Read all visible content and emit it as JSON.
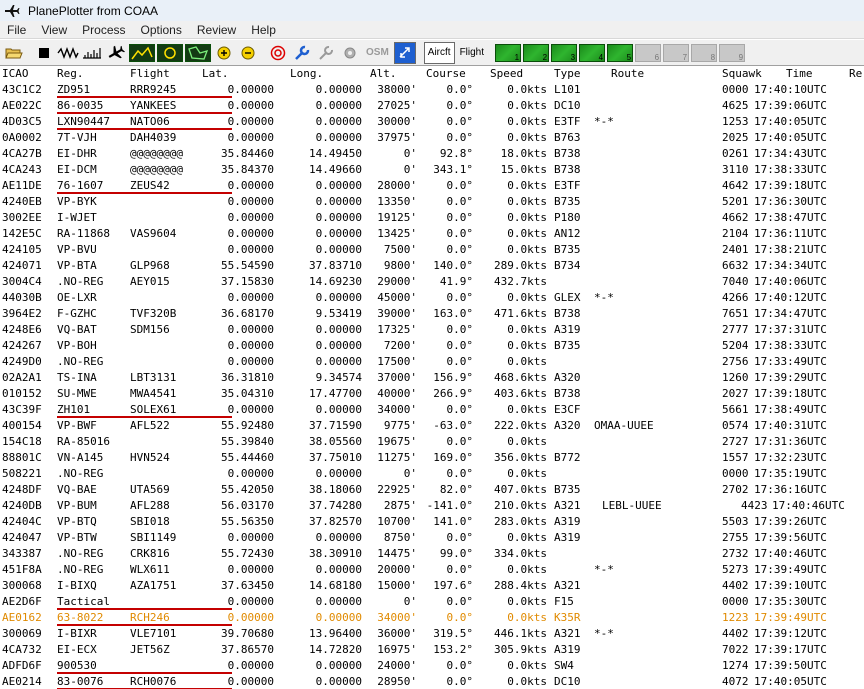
{
  "window": {
    "title": "PlanePlotter from COAA",
    "app_icon": "airplane-icon"
  },
  "menu": [
    "File",
    "View",
    "Process",
    "Options",
    "Review",
    "Help"
  ],
  "toolbar": {
    "text_buttons": {
      "osm": "OSM",
      "aircraft": "Aircft",
      "flight": "Flight"
    },
    "map_numbers": [
      "1",
      "2",
      "3",
      "4",
      "5"
    ],
    "grey_numbers": [
      "6",
      "7",
      "8",
      "9"
    ]
  },
  "table": {
    "columns": [
      "ICAO",
      "Reg.",
      "Flight",
      "Lat.",
      "Long.",
      "Alt.",
      "Course",
      "Speed",
      "Type",
      "Route",
      "Squawk",
      "Time",
      "Re"
    ],
    "rows": [
      {
        "icao": "43C1C2",
        "reg": "ZD951",
        "flight": "RRR9245",
        "lat": "0.00000",
        "long": "0.00000",
        "alt": "38000'",
        "course": "0.0°",
        "speed": "0.0kts",
        "type": "L101",
        "route": "",
        "squawk": "0000",
        "time": "17:40:10UTC",
        "underline": true
      },
      {
        "icao": "AE022C",
        "reg": "86-0035",
        "flight": "YANKEES",
        "lat": "0.00000",
        "long": "0.00000",
        "alt": "27025'",
        "course": "0.0°",
        "speed": "0.0kts",
        "type": "DC10",
        "route": "",
        "squawk": "4625",
        "time": "17:39:06UTC",
        "underline": true
      },
      {
        "icao": "4D03C5",
        "reg": "LXN90447",
        "flight": "NATO06",
        "lat": "0.00000",
        "long": "0.00000",
        "alt": "30000'",
        "course": "0.0°",
        "speed": "0.0kts",
        "type": "E3TF",
        "route": "*-*",
        "squawk": "1253",
        "time": "17:40:05UTC",
        "underline": true
      },
      {
        "icao": "0A0002",
        "reg": "7T-VJH",
        "flight": "DAH4039",
        "lat": "0.00000",
        "long": "0.00000",
        "alt": "37975'",
        "course": "0.0°",
        "speed": "0.0kts",
        "type": "B763",
        "route": "",
        "squawk": "2025",
        "time": "17:40:05UTC"
      },
      {
        "icao": "4CA27B",
        "reg": "EI-DHR",
        "flight": "@@@@@@@@",
        "lat": "35.84460",
        "long": "14.49450",
        "alt": "0'",
        "course": "92.8°",
        "speed": "18.0kts",
        "type": "B738",
        "route": "",
        "squawk": "0261",
        "time": "17:34:43UTC"
      },
      {
        "icao": "4CA243",
        "reg": "EI-DCM",
        "flight": "@@@@@@@@",
        "lat": "35.84370",
        "long": "14.49660",
        "alt": "0'",
        "course": "343.1°",
        "speed": "15.0kts",
        "type": "B738",
        "route": "",
        "squawk": "3110",
        "time": "17:38:33UTC"
      },
      {
        "icao": "AE11DE",
        "reg": "76-1607",
        "flight": "ZEUS42",
        "lat": "0.00000",
        "long": "0.00000",
        "alt": "28000'",
        "course": "0.0°",
        "speed": "0.0kts",
        "type": "E3TF",
        "route": "",
        "squawk": "4642",
        "time": "17:39:18UTC",
        "underline": true
      },
      {
        "icao": "4240EB",
        "reg": "VP-BYK",
        "flight": "",
        "lat": "0.00000",
        "long": "0.00000",
        "alt": "13350'",
        "course": "0.0°",
        "speed": "0.0kts",
        "type": "B735",
        "route": "",
        "squawk": "5201",
        "time": "17:36:30UTC"
      },
      {
        "icao": "3002EE",
        "reg": "I-WJET",
        "flight": "",
        "lat": "0.00000",
        "long": "0.00000",
        "alt": "19125'",
        "course": "0.0°",
        "speed": "0.0kts",
        "type": "P180",
        "route": "",
        "squawk": "4662",
        "time": "17:38:47UTC"
      },
      {
        "icao": "142E5C",
        "reg": "RA-11868",
        "flight": "VAS9604",
        "lat": "0.00000",
        "long": "0.00000",
        "alt": "13425'",
        "course": "0.0°",
        "speed": "0.0kts",
        "type": "AN12",
        "route": "",
        "squawk": "2104",
        "time": "17:36:11UTC"
      },
      {
        "icao": "424105",
        "reg": "VP-BVU",
        "flight": "",
        "lat": "0.00000",
        "long": "0.00000",
        "alt": "7500'",
        "course": "0.0°",
        "speed": "0.0kts",
        "type": "B735",
        "route": "",
        "squawk": "2401",
        "time": "17:38:21UTC"
      },
      {
        "icao": "424071",
        "reg": "VP-BTA",
        "flight": "GLP968",
        "lat": "55.54590",
        "long": "37.83710",
        "alt": "9800'",
        "course": "140.0°",
        "speed": "289.0kts",
        "type": "B734",
        "route": "",
        "squawk": "6632",
        "time": "17:34:34UTC"
      },
      {
        "icao": "3004C4",
        "reg": ".NO-REG",
        "flight": "AEY015",
        "lat": "37.15830",
        "long": "14.69230",
        "alt": "29000'",
        "course": "41.9°",
        "speed": "432.7kts",
        "type": "",
        "route": "",
        "squawk": "7040",
        "time": "17:40:06UTC"
      },
      {
        "icao": "44030B",
        "reg": "OE-LXR",
        "flight": "",
        "lat": "0.00000",
        "long": "0.00000",
        "alt": "45000'",
        "course": "0.0°",
        "speed": "0.0kts",
        "type": "GLEX",
        "route": "*-*",
        "squawk": "4266",
        "time": "17:40:12UTC"
      },
      {
        "icao": "3964E2",
        "reg": "F-GZHC",
        "flight": "TVF320B",
        "lat": "36.68170",
        "long": "9.53419",
        "alt": "39000'",
        "course": "163.0°",
        "speed": "471.6kts",
        "type": "B738",
        "route": "",
        "squawk": "7651",
        "time": "17:34:47UTC"
      },
      {
        "icao": "4248E6",
        "reg": "VQ-BAT",
        "flight": "SDM156",
        "lat": "0.00000",
        "long": "0.00000",
        "alt": "17325'",
        "course": "0.0°",
        "speed": "0.0kts",
        "type": "A319",
        "route": "",
        "squawk": "2777",
        "time": "17:37:31UTC"
      },
      {
        "icao": "424267",
        "reg": "VP-BOH",
        "flight": "",
        "lat": "0.00000",
        "long": "0.00000",
        "alt": "7200'",
        "course": "0.0°",
        "speed": "0.0kts",
        "type": "B735",
        "route": "",
        "squawk": "5204",
        "time": "17:38:33UTC"
      },
      {
        "icao": "4249D0",
        "reg": ".NO-REG",
        "flight": "",
        "lat": "0.00000",
        "long": "0.00000",
        "alt": "17500'",
        "course": "0.0°",
        "speed": "0.0kts",
        "type": "",
        "route": "",
        "squawk": "2756",
        "time": "17:33:49UTC"
      },
      {
        "icao": "02A2A1",
        "reg": "TS-INA",
        "flight": "LBT3131",
        "lat": "36.31810",
        "long": "9.34574",
        "alt": "37000'",
        "course": "156.9°",
        "speed": "468.6kts",
        "type": "A320",
        "route": "",
        "squawk": "1260",
        "time": "17:39:29UTC"
      },
      {
        "icao": "010152",
        "reg": "SU-MWE",
        "flight": "MWA4541",
        "lat": "35.04310",
        "long": "17.47700",
        "alt": "40000'",
        "course": "266.9°",
        "speed": "403.6kts",
        "type": "B738",
        "route": "",
        "squawk": "2027",
        "time": "17:39:18UTC"
      },
      {
        "icao": "43C39F",
        "reg": "ZH101",
        "flight": "SOLEX61",
        "lat": "0.00000",
        "long": "0.00000",
        "alt": "34000'",
        "course": "0.0°",
        "speed": "0.0kts",
        "type": "E3CF",
        "route": "",
        "squawk": "5661",
        "time": "17:38:49UTC",
        "underline": true
      },
      {
        "icao": "400154",
        "reg": "VP-BWF",
        "flight": "AFL522",
        "lat": "55.92480",
        "long": "37.71590",
        "alt": "9775'",
        "course": "-63.0°",
        "speed": "222.0kts",
        "type": "A320",
        "route": "OMAA-UUEE",
        "squawk": "0574",
        "time": "17:40:31UTC"
      },
      {
        "icao": "154C18",
        "reg": "RA-85016",
        "flight": "",
        "lat": "55.39840",
        "long": "38.05560",
        "alt": "19675'",
        "course": "0.0°",
        "speed": "0.0kts",
        "type": "",
        "route": "",
        "squawk": "2727",
        "time": "17:31:36UTC"
      },
      {
        "icao": "88801C",
        "reg": "VN-A145",
        "flight": "HVN524",
        "lat": "55.44460",
        "long": "37.75010",
        "alt": "11275'",
        "course": "169.0°",
        "speed": "356.0kts",
        "type": "B772",
        "route": "",
        "squawk": "1557",
        "time": "17:32:23UTC"
      },
      {
        "icao": "508221",
        "reg": ".NO-REG",
        "flight": "",
        "lat": "0.00000",
        "long": "0.00000",
        "alt": "0'",
        "course": "0.0°",
        "speed": "0.0kts",
        "type": "",
        "route": "",
        "squawk": "0000",
        "time": "17:35:19UTC"
      },
      {
        "icao": "4248DF",
        "reg": "VQ-BAE",
        "flight": "UTA569",
        "lat": "55.42050",
        "long": "38.18060",
        "alt": "22925'",
        "course": "82.0°",
        "speed": "407.0kts",
        "type": "B735",
        "route": "",
        "squawk": "2702",
        "time": "17:36:16UTC"
      },
      {
        "icao": "4240DB",
        "reg": "VP-BUM",
        "flight": "AFL288",
        "lat": "56.03170",
        "long": "37.74280",
        "alt": "2875'",
        "course": "-141.0°",
        "speed": "210.0kts",
        "type": "A321",
        "route": "LEBL-UUEE",
        "squawk": "4423",
        "time": "17:40:46UTC",
        "shifted": true
      },
      {
        "icao": "42404C",
        "reg": "VP-BTQ",
        "flight": "SBI018",
        "lat": "55.56350",
        "long": "37.82570",
        "alt": "10700'",
        "course": "141.0°",
        "speed": "283.0kts",
        "type": "A319",
        "route": "",
        "squawk": "5503",
        "time": "17:39:26UTC"
      },
      {
        "icao": "424047",
        "reg": "VP-BTW",
        "flight": "SBI1149",
        "lat": "0.00000",
        "long": "0.00000",
        "alt": "8750'",
        "course": "0.0°",
        "speed": "0.0kts",
        "type": "A319",
        "route": "",
        "squawk": "2755",
        "time": "17:39:56UTC"
      },
      {
        "icao": "343387",
        "reg": ".NO-REG",
        "flight": "CRK816",
        "lat": "55.72430",
        "long": "38.30910",
        "alt": "14475'",
        "course": "99.0°",
        "speed": "334.0kts",
        "type": "",
        "route": "",
        "squawk": "2732",
        "time": "17:40:46UTC"
      },
      {
        "icao": "451F8A",
        "reg": ".NO-REG",
        "flight": "WLX611",
        "lat": "0.00000",
        "long": "0.00000",
        "alt": "20000'",
        "course": "0.0°",
        "speed": "0.0kts",
        "type": "",
        "route": "*-*",
        "squawk": "5273",
        "time": "17:39:49UTC"
      },
      {
        "icao": "300068",
        "reg": "I-BIXQ",
        "flight": "AZA1751",
        "lat": "37.63450",
        "long": "14.68180",
        "alt": "15000'",
        "course": "197.6°",
        "speed": "288.4kts",
        "type": "A321",
        "route": "",
        "squawk": "4402",
        "time": "17:39:10UTC"
      },
      {
        "icao": "AE2D6F",
        "reg": "Tactical",
        "flight": "",
        "lat": "0.00000",
        "long": "0.00000",
        "alt": "0'",
        "course": "0.0°",
        "speed": "0.0kts",
        "type": "F15",
        "route": "",
        "squawk": "0000",
        "time": "17:35:30UTC",
        "underline": true
      },
      {
        "icao": "AE0162",
        "reg": "63-8022",
        "flight": "RCH246",
        "lat": "0.00000",
        "long": "0.00000",
        "alt": "34000'",
        "course": "0.0°",
        "speed": "0.0kts",
        "type": "K35R",
        "route": "",
        "squawk": "1223",
        "time": "17:39:49UTC",
        "underline": true,
        "highlight": true
      },
      {
        "icao": "300069",
        "reg": "I-BIXR",
        "flight": "VLE7101",
        "lat": "39.70680",
        "long": "13.96400",
        "alt": "36000'",
        "course": "319.5°",
        "speed": "446.1kts",
        "type": "A321",
        "route": "*-*",
        "squawk": "4402",
        "time": "17:39:12UTC"
      },
      {
        "icao": "4CA732",
        "reg": "EI-ECX",
        "flight": "JET56Z",
        "lat": "37.86570",
        "long": "14.72820",
        "alt": "16975'",
        "course": "153.2°",
        "speed": "305.9kts",
        "type": "A319",
        "route": "",
        "squawk": "7022",
        "time": "17:39:17UTC"
      },
      {
        "icao": "ADFD6F",
        "reg": "900530",
        "flight": "",
        "lat": "0.00000",
        "long": "0.00000",
        "alt": "24000'",
        "course": "0.0°",
        "speed": "0.0kts",
        "type": "SW4",
        "route": "",
        "squawk": "1274",
        "time": "17:39:50UTC",
        "underline": true
      },
      {
        "icao": "AE0214",
        "reg": "83-0076",
        "flight": "RCH0076",
        "lat": "0.00000",
        "long": "0.00000",
        "alt": "28950'",
        "course": "0.0°",
        "speed": "0.0kts",
        "type": "DC10",
        "route": "",
        "squawk": "4072",
        "time": "17:40:05UTC",
        "underline": true
      }
    ]
  },
  "colors": {
    "underline": "#c40000",
    "highlight_row": "#e08a00",
    "titlebar_bg": "#e9f0f8"
  }
}
